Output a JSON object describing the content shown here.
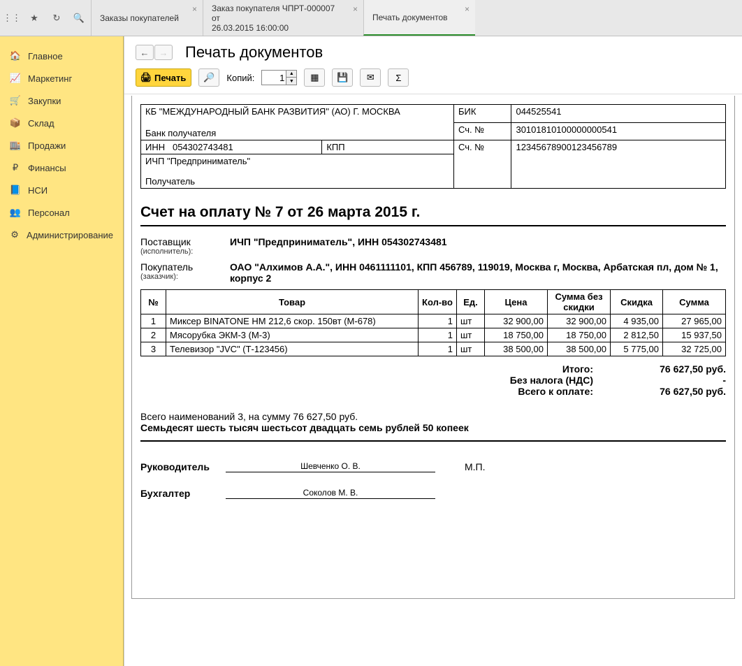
{
  "tabs": [
    {
      "line1": "Заказы покупателей",
      "line2": ""
    },
    {
      "line1": "Заказ покупателя ЧПРТ-000007 от",
      "line2": "26.03.2015 16:00:00"
    },
    {
      "line1": "Печать документов",
      "line2": ""
    }
  ],
  "sidebar": {
    "items": [
      {
        "label": "Главное"
      },
      {
        "label": "Маркетинг"
      },
      {
        "label": "Закупки"
      },
      {
        "label": "Склад"
      },
      {
        "label": "Продажи"
      },
      {
        "label": "Финансы"
      },
      {
        "label": "НСИ"
      },
      {
        "label": "Персонал"
      },
      {
        "label": "Администрирование"
      }
    ]
  },
  "page": {
    "title": "Печать документов"
  },
  "toolbar": {
    "print": "Печать",
    "copies_label": "Копий:",
    "copies_value": "1"
  },
  "bank": {
    "bank_name": "КБ \"МЕЖДУНАРОДНЫЙ БАНК РАЗВИТИЯ\" (АО) Г. МОСКВА",
    "bank_recipient_label": "Банк получателя",
    "bik_label": "БИК",
    "bik": "044525541",
    "acc_label": "Сч. №",
    "corr_acc": "30101810100000000541",
    "inn_label": "ИНН",
    "inn": "054302743481",
    "kpp_label": "КПП",
    "kpp": "",
    "payer_acc_label": "Сч. №",
    "payer_acc": "12345678900123456789",
    "recipient_name": "ИЧП \"Предприниматель\"",
    "recipient_label": "Получатель"
  },
  "invoice": {
    "title": "Счет на оплату № 7 от 26 марта 2015 г.",
    "supplier_label": "Поставщик",
    "supplier_sub": "(исполнитель):",
    "supplier": "ИЧП \"Предприниматель\", ИНН 054302743481",
    "buyer_label": "Покупатель",
    "buyer_sub": "(заказчик):",
    "buyer": "ОАО \"Алхимов А.А.\", ИНН 0461111101, КПП 456789, 119019, Москва г, Москва, Арбатская пл, дом № 1, корпус 2",
    "headers": {
      "n": "№",
      "name": "Товар",
      "qty": "Кол-во",
      "unit": "Ед.",
      "price": "Цена",
      "sum_nod": "Сумма без скидки",
      "discount": "Скидка",
      "sum": "Сумма"
    },
    "rows": [
      {
        "n": "1",
        "name": "Миксер BINATONE HM 212,6 скор. 150вт (М-678)",
        "qty": "1",
        "unit": "шт",
        "price": "32 900,00",
        "sum_nod": "32 900,00",
        "discount": "4 935,00",
        "sum": "27 965,00"
      },
      {
        "n": "2",
        "name": "Мясорубка ЭКМ-3 (М-3)",
        "qty": "1",
        "unit": "шт",
        "price": "18 750,00",
        "sum_nod": "18 750,00",
        "discount": "2 812,50",
        "sum": "15 937,50"
      },
      {
        "n": "3",
        "name": "Телевизор \"JVC\" (Т-123456)",
        "qty": "1",
        "unit": "шт",
        "price": "38 500,00",
        "sum_nod": "38 500,00",
        "discount": "5 775,00",
        "sum": "32 725,00"
      }
    ],
    "totals": {
      "itogo_label": "Итого:",
      "itogo": "76 627,50 руб.",
      "vat_label": "Без налога (НДС)",
      "vat": "-",
      "total_label": "Всего к оплате:",
      "total": "76 627,50 руб."
    },
    "summary_line": "Всего наименований 3, на сумму 76 627,50 руб.",
    "summary_words": "Семьдесят шесть тысяч шестьсот двадцать семь рублей 50 копеек",
    "sig": {
      "head_label": "Руководитель",
      "head_name": "Шевченко О. В.",
      "mp": "М.П.",
      "acc_label": "Бухгалтер",
      "acc_name": "Соколов М. В."
    }
  }
}
